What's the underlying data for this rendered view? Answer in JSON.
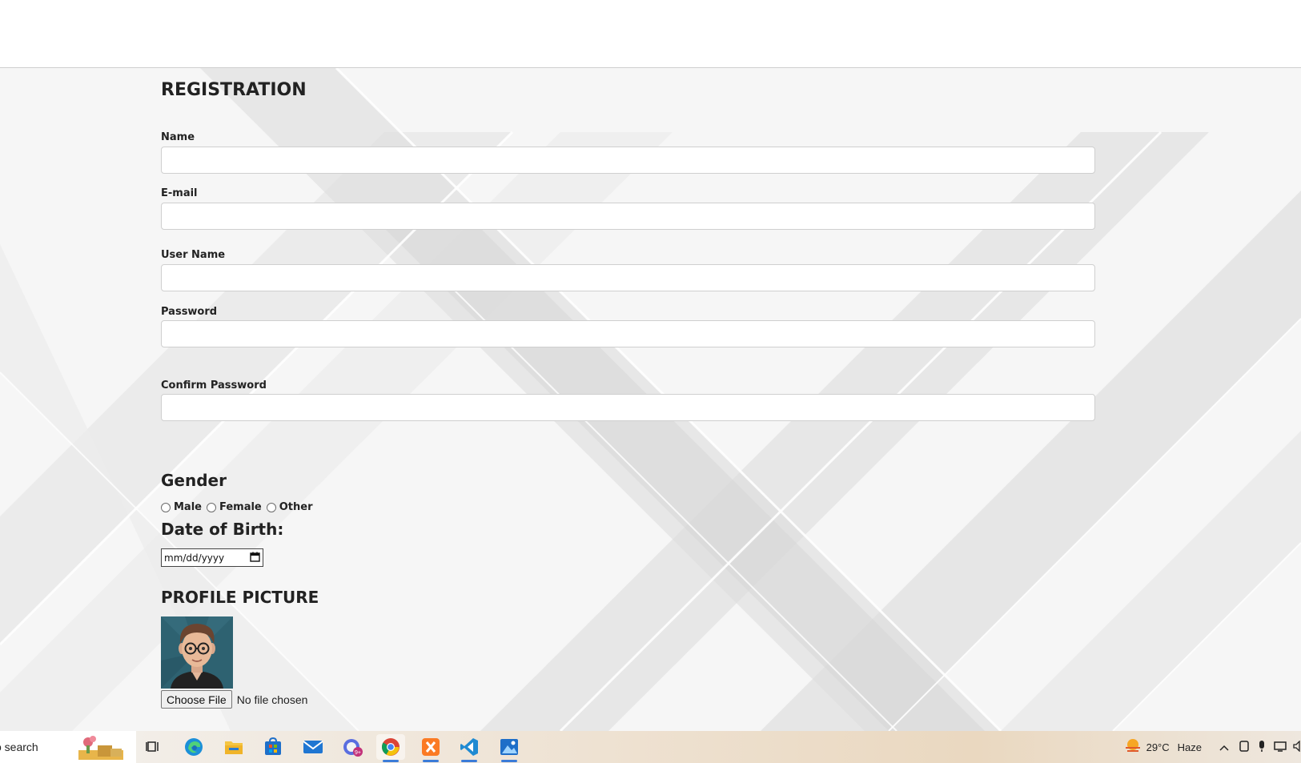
{
  "form": {
    "title": "REGISTRATION",
    "fields": [
      {
        "label": "Name",
        "value": ""
      },
      {
        "label": "E-mail",
        "value": ""
      },
      {
        "label": "User Name",
        "value": ""
      },
      {
        "label": "Password",
        "value": ""
      },
      {
        "label": "Confirm Password",
        "value": ""
      }
    ],
    "gender_heading": "Gender",
    "gender_options": [
      "Male",
      "Female",
      "Other"
    ],
    "dob_heading": "Date of Birth:",
    "dob_placeholder": "mm/dd/yyyy",
    "profile_heading": "PROFILE PICTURE",
    "file_button": "Choose File",
    "file_status": "No file chosen"
  },
  "taskbar": {
    "search_text": "o search",
    "apps": [
      "widgets-icon",
      "task-view-icon",
      "edge-icon",
      "file-explorer-icon",
      "store-icon",
      "mail-icon",
      "copilot-icon",
      "chrome-icon",
      "xampp-icon",
      "vscode-icon",
      "photos-icon"
    ],
    "weather_temp": "29°C",
    "weather_status": "Haze"
  }
}
